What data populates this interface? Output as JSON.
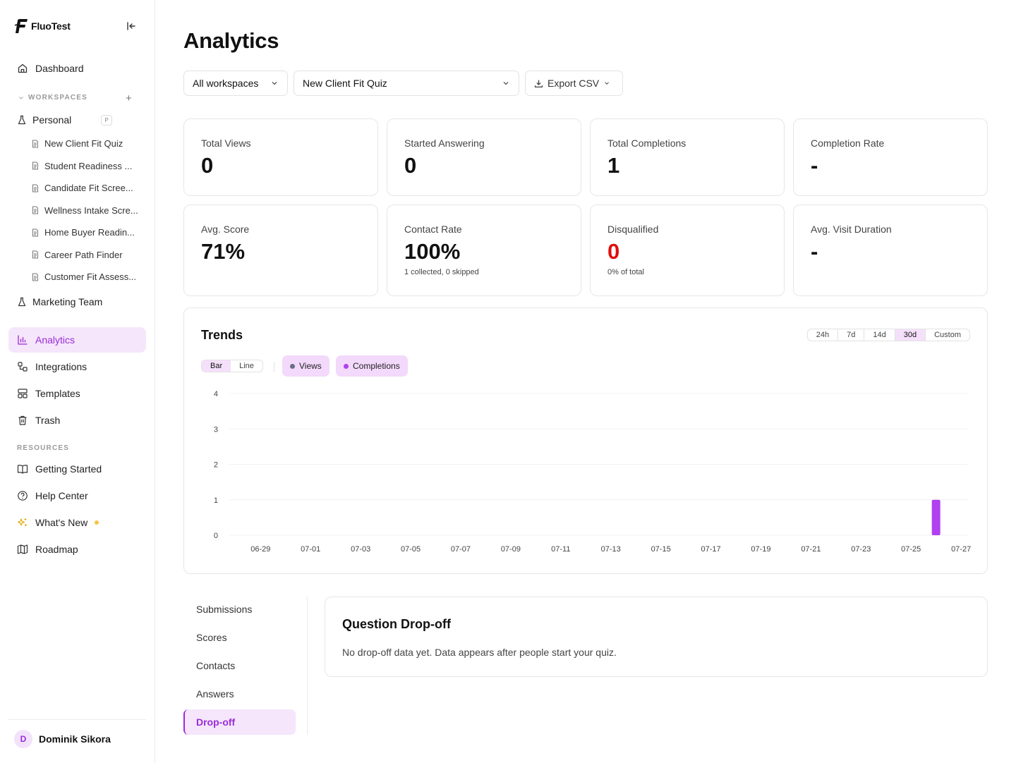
{
  "app": {
    "name": "FluoTest"
  },
  "sidebar": {
    "dashboard": "Dashboard",
    "workspaces_label": "WORKSPACES",
    "add_workspace": "+",
    "personal": {
      "label": "Personal",
      "badge": "P"
    },
    "quizzes": [
      "New Client Fit Quiz",
      "Student Readiness ...",
      "Candidate Fit Scree...",
      "Wellness Intake Scre...",
      "Home Buyer Readin...",
      "Career Path Finder",
      "Customer Fit Assess..."
    ],
    "marketing": "Marketing Team",
    "nav": [
      "Analytics",
      "Integrations",
      "Templates",
      "Trash"
    ],
    "resources_label": "RESOURCES",
    "resources": [
      "Getting Started",
      "Help Center",
      "What's New",
      "Roadmap"
    ],
    "user": {
      "initial": "D",
      "name": "Dominik Sikora"
    }
  },
  "header": {
    "title": "Analytics",
    "workspace_select": "All workspaces",
    "quiz_select": "New Client Fit Quiz",
    "export": "Export CSV"
  },
  "stats": [
    {
      "label": "Total Views",
      "value": "0",
      "sub": ""
    },
    {
      "label": "Started Answering",
      "value": "0",
      "sub": ""
    },
    {
      "label": "Total Completions",
      "value": "1",
      "sub": ""
    },
    {
      "label": "Completion Rate",
      "value": "-",
      "sub": ""
    },
    {
      "label": "Avg. Score",
      "value": "71%",
      "sub": ""
    },
    {
      "label": "Contact Rate",
      "value": "100%",
      "sub": "1 collected, 0 skipped"
    },
    {
      "label": "Disqualified",
      "value": "0",
      "sub": "0% of total"
    },
    {
      "label": "Avg. Visit Duration",
      "value": "-",
      "sub": ""
    }
  ],
  "trends": {
    "title": "Trends",
    "ranges": [
      "24h",
      "7d",
      "14d",
      "30d",
      "Custom"
    ],
    "active_range": "30d",
    "types": [
      "Bar",
      "Line"
    ],
    "active_type": "Bar",
    "legend": [
      {
        "name": "Views",
        "color": "#6b6f85"
      },
      {
        "name": "Completions",
        "color": "#b040f0"
      }
    ]
  },
  "chart_data": {
    "type": "bar",
    "x": [
      "06-28",
      "06-29",
      "06-30",
      "07-01",
      "07-02",
      "07-03",
      "07-04",
      "07-05",
      "07-06",
      "07-07",
      "07-08",
      "07-09",
      "07-10",
      "07-11",
      "07-12",
      "07-13",
      "07-14",
      "07-15",
      "07-16",
      "07-17",
      "07-18",
      "07-19",
      "07-20",
      "07-21",
      "07-22",
      "07-23",
      "07-24",
      "07-25",
      "07-26",
      "07-27"
    ],
    "xtick_labels": [
      "06-29",
      "07-01",
      "07-03",
      "07-05",
      "07-07",
      "07-09",
      "07-11",
      "07-13",
      "07-15",
      "07-17",
      "07-19",
      "07-21",
      "07-23",
      "07-25",
      "07-27"
    ],
    "series": [
      {
        "name": "Views",
        "color": "#6b6f85",
        "values": [
          0,
          0,
          0,
          0,
          0,
          0,
          0,
          0,
          0,
          0,
          0,
          0,
          0,
          0,
          0,
          0,
          0,
          0,
          0,
          0,
          0,
          0,
          0,
          0,
          0,
          0,
          0,
          0,
          0,
          0
        ]
      },
      {
        "name": "Completions",
        "color": "#b040f0",
        "values": [
          0,
          0,
          0,
          0,
          0,
          0,
          0,
          0,
          0,
          0,
          0,
          0,
          0,
          0,
          0,
          0,
          0,
          0,
          0,
          0,
          0,
          0,
          0,
          0,
          0,
          0,
          0,
          0,
          1,
          0
        ]
      }
    ],
    "ylim": [
      0,
      4
    ],
    "yticks": [
      0,
      1,
      2,
      3,
      4
    ],
    "grid": true
  },
  "detail_tabs": [
    "Submissions",
    "Scores",
    "Contacts",
    "Answers",
    "Drop-off"
  ],
  "active_tab": "Drop-off",
  "dropoff": {
    "title": "Question Drop-off",
    "text": "No drop-off data yet. Data appears after people start your quiz."
  }
}
